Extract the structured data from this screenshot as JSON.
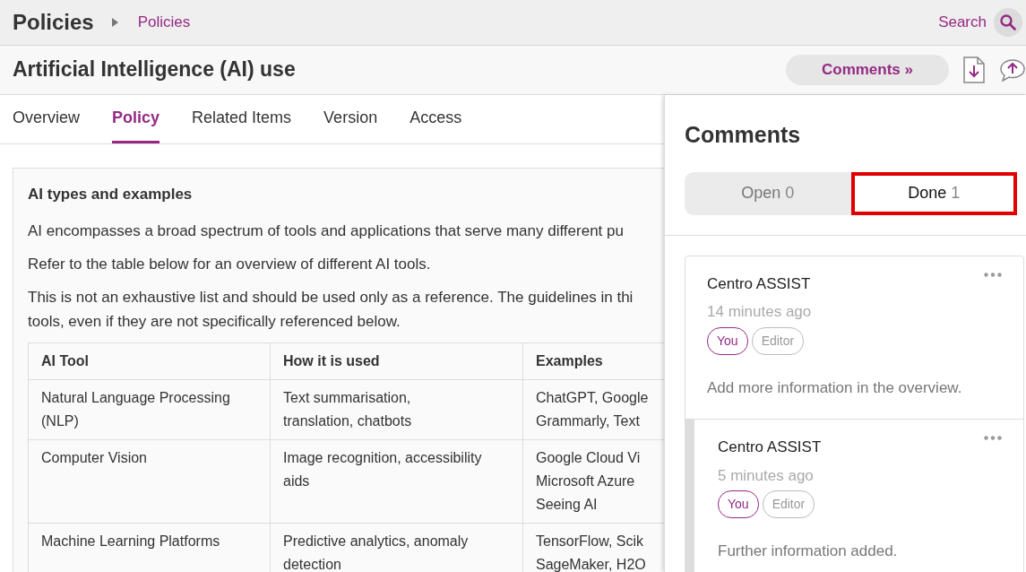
{
  "header": {
    "title": "Policies",
    "breadcrumb": "Policies",
    "search_label": "Search"
  },
  "page": {
    "title": "Artificial Intelligence (AI) use",
    "comments_button": {
      "label": "Comments",
      "icon_text": "»"
    }
  },
  "tabs": [
    {
      "label": "Overview",
      "selected": false
    },
    {
      "label": "Policy",
      "selected": true
    },
    {
      "label": "Related Items",
      "selected": false
    },
    {
      "label": "Version",
      "selected": false
    },
    {
      "label": "Access",
      "selected": false
    }
  ],
  "section": {
    "heading": "AI types and examples",
    "paragraphs": [
      [
        "AI encompasses a broad spectrum of tools and applications that serve many different pu"
      ],
      [
        "Refer to the table below for an overview of different AI tools."
      ],
      [
        "This is not an exhaustive list and should be used only as a reference. The guidelines in thi",
        "tools, even if they are not specifically referenced below."
      ]
    ],
    "table": {
      "columns": [
        "AI Tool",
        "How it is used",
        "Examples"
      ],
      "rows": [
        [
          [
            "Natural Language Processing",
            "(NLP)"
          ],
          [
            "Text summarisation,",
            "translation, chatbots"
          ],
          [
            "ChatGPT, Google",
            "Grammarly, Text"
          ]
        ],
        [
          [
            "Computer Vision"
          ],
          [
            "Image recognition, accessibility",
            "aids"
          ],
          [
            "Google Cloud Vi",
            "Microsoft Azure",
            "Seeing AI"
          ]
        ],
        [
          [
            "Machine Learning Platforms"
          ],
          [
            "Predictive analytics, anomaly",
            "detection"
          ],
          [
            "TensorFlow, Scik",
            "SageMaker, H2O"
          ]
        ]
      ]
    }
  },
  "comments_panel": {
    "title": "Comments",
    "filters": [
      {
        "label": "Open",
        "count": "0",
        "selected": false,
        "highlighted": false
      },
      {
        "label": "Done",
        "count": "1",
        "selected": true,
        "highlighted": true
      }
    ],
    "comments": [
      {
        "author": "Centro ASSIST",
        "time": "14 minutes ago",
        "tags": [
          {
            "label": "You",
            "kind": "self"
          },
          {
            "label": "Editor",
            "kind": "role"
          }
        ],
        "text": "Add more information in the overview.",
        "replies": [
          {
            "author": "Centro ASSIST",
            "time": "5 minutes ago",
            "tags": [
              {
                "label": "You",
                "kind": "self"
              },
              {
                "label": "Editor",
                "kind": "role"
              }
            ],
            "text": "Further information added."
          }
        ]
      }
    ]
  }
}
